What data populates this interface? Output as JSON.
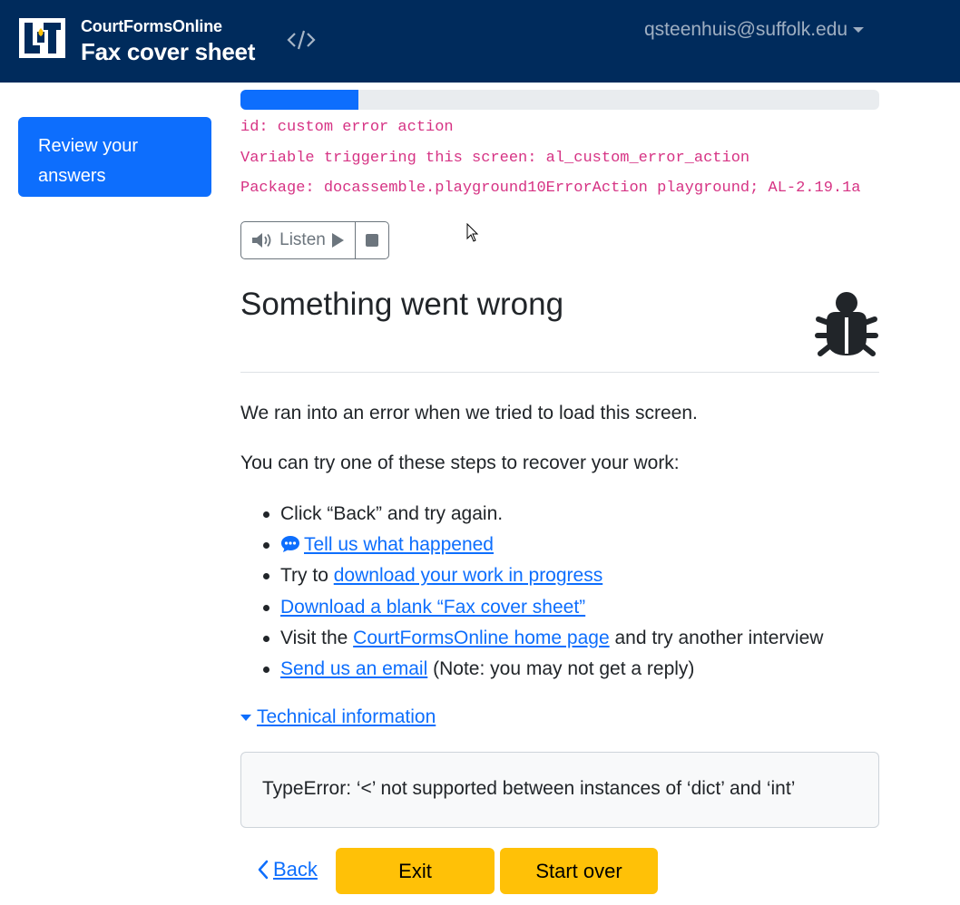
{
  "navbar": {
    "brand_subtitle": "CourtFormsOnline",
    "brand_title": "Fax cover sheet",
    "source_icon": "code-icon",
    "user_email": "qsteenhuis@suffolk.edu",
    "bg_color": "#002b5c"
  },
  "sidebar": {
    "review_label": "Review your answers"
  },
  "progress": {
    "fraction": 0.185
  },
  "debug": {
    "id_line": "id: custom error action",
    "variable_line": "Variable triggering this screen: al_custom_error_action",
    "package_line": "Package: docassemble.playground10ErrorAction playground; AL-2.19.1a"
  },
  "audio": {
    "listen_label": "Listen",
    "speaker_icon": "volume-icon",
    "play_icon": "play-icon",
    "stop_icon": "stop-icon"
  },
  "main": {
    "heading": "Something went wrong",
    "heading_icon": "bug-icon",
    "intro": "We ran into an error when we tried to load this screen.",
    "steps_intro": "You can try one of these steps to recover your work:",
    "steps": {
      "step1": "Click “Back” and try again.",
      "step2_link": "Tell us what happened",
      "step3_prefix": "Try to ",
      "step3_link": "download your work in progress",
      "step4_link": "Download a blank “Fax cover sheet”",
      "step5_prefix": "Visit the ",
      "step5_link": "CourtFormsOnline home page",
      "step5_suffix": " and try another interview",
      "step6_link": "Send us an email",
      "step6_suffix": " (Note: you may not get a reply)"
    },
    "tech_toggle": "Technical information",
    "error_text": "TypeError: ‘<’ not supported between instances of ‘dict’ and ‘int’"
  },
  "buttons": {
    "back": "Back",
    "exit": "Exit",
    "start_over": "Start over"
  },
  "colors": {
    "accent": "#0d6efd",
    "warning": "#ffc107",
    "debug_pink": "#d63384"
  }
}
